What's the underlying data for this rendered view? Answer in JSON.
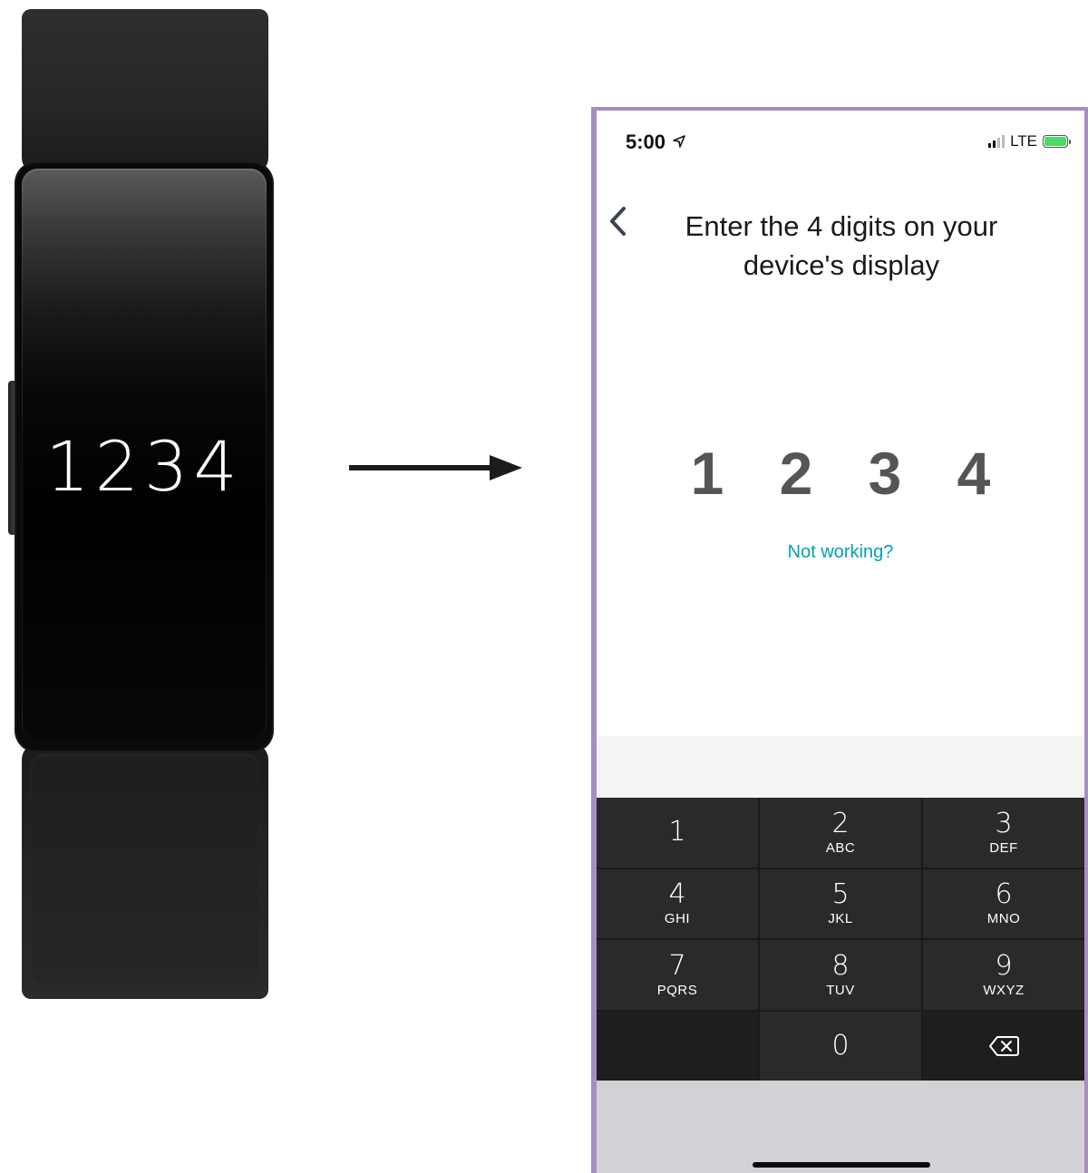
{
  "tracker": {
    "code": "1234"
  },
  "phone": {
    "status_bar": {
      "time": "5:00",
      "network": "LTE"
    },
    "header": {
      "back_icon": "chevron-left-icon",
      "title": "Enter the 4 digits on your device's display"
    },
    "code_digits": [
      "1",
      "2",
      "3",
      "4"
    ],
    "not_working_link": "Not working?",
    "keypad": {
      "keys": [
        {
          "digit": "1",
          "letters": ""
        },
        {
          "digit": "2",
          "letters": "ABC"
        },
        {
          "digit": "3",
          "letters": "DEF"
        },
        {
          "digit": "4",
          "letters": "GHI"
        },
        {
          "digit": "5",
          "letters": "JKL"
        },
        {
          "digit": "6",
          "letters": "MNO"
        },
        {
          "digit": "7",
          "letters": "PQRS"
        },
        {
          "digit": "8",
          "letters": "TUV"
        },
        {
          "digit": "9",
          "letters": "WXYZ"
        },
        {
          "digit": "0",
          "letters": ""
        }
      ],
      "backspace_icon": "backspace-icon"
    }
  },
  "colors": {
    "frame": "#a48fc1",
    "link": "#00a3ad",
    "keypad_bg": "#2a2a2b",
    "digit": "#555555"
  }
}
